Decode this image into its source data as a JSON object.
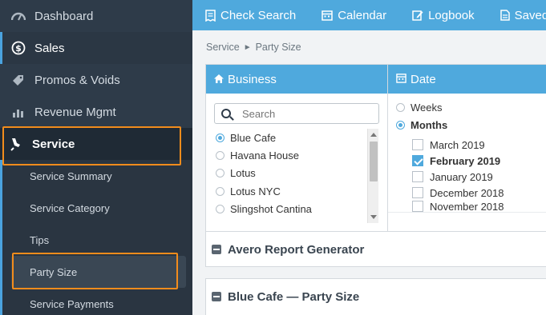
{
  "sidebar": {
    "items": [
      {
        "label": "Dashboard",
        "icon": "dashboard-gauge-icon"
      },
      {
        "label": "Sales",
        "icon": "dollar-circle-icon"
      },
      {
        "label": "Promos & Voids",
        "icon": "tag-icon"
      },
      {
        "label": "Revenue Mgmt",
        "icon": "bar-chart-icon"
      },
      {
        "label": "Service",
        "icon": "service-bell-icon"
      }
    ],
    "submenu": [
      {
        "label": "Service Summary"
      },
      {
        "label": "Service Category"
      },
      {
        "label": "Tips"
      },
      {
        "label": "Party Size"
      },
      {
        "label": "Service Payments"
      }
    ]
  },
  "topbar": {
    "buttons": [
      {
        "label": "Check Search",
        "icon": "receipt-icon"
      },
      {
        "label": "Calendar",
        "icon": "calendar-icon"
      },
      {
        "label": "Logbook",
        "icon": "edit-icon"
      },
      {
        "label": "Saved",
        "icon": "document-icon"
      }
    ]
  },
  "breadcrumb": {
    "parent": "Service",
    "separator": "►",
    "current": "Party Size"
  },
  "business_panel": {
    "title": "Business",
    "search_placeholder": "Search",
    "options": [
      {
        "label": "Blue Cafe",
        "selected": true
      },
      {
        "label": "Havana House",
        "selected": false
      },
      {
        "label": "Lotus",
        "selected": false
      },
      {
        "label": "Lotus NYC",
        "selected": false
      },
      {
        "label": "Slingshot Cantina",
        "selected": false
      }
    ]
  },
  "date_panel": {
    "title": "Date",
    "modes": [
      {
        "label": "Weeks",
        "selected": false
      },
      {
        "label": "Months",
        "selected": true
      }
    ],
    "months": [
      {
        "label": "March 2019",
        "checked": false
      },
      {
        "label": "February 2019",
        "checked": true
      },
      {
        "label": "January 2019",
        "checked": false
      },
      {
        "label": "December 2018",
        "checked": false
      },
      {
        "label": "November 2018",
        "checked": false
      }
    ]
  },
  "sections": {
    "report_generator": "Avero Report Generator",
    "party_size": "Blue Cafe — Party Size"
  },
  "colors": {
    "accent": "#4fa9dd",
    "sidebar": "#2e3b49",
    "highlight": "#f28c1c"
  }
}
